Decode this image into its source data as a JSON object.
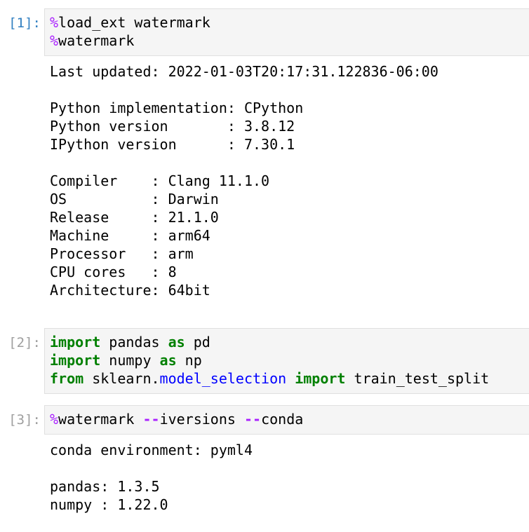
{
  "cells": [
    {
      "prompt": "[1]:",
      "input": {
        "line1": {
          "magic": "%",
          "text": "load_ext watermark"
        },
        "line2": {
          "magic": "%",
          "text": "watermark"
        }
      },
      "output": [
        "Last updated: 2022-01-03T20:17:31.122836-06:00",
        "",
        "Python implementation: CPython",
        "Python version       : 3.8.12",
        "IPython version      : 7.30.1",
        "",
        "Compiler    : Clang 11.1.0",
        "OS          : Darwin",
        "Release     : 21.1.0",
        "Machine     : arm64",
        "Processor   : arm",
        "CPU cores   : 8",
        "Architecture: 64bit"
      ]
    },
    {
      "prompt": "[2]:",
      "input": {
        "line1": {
          "kw1": "import",
          "name": " pandas ",
          "kw2": "as",
          "alias": " pd"
        },
        "line2": {
          "kw1": "import",
          "name": " numpy ",
          "kw2": "as",
          "alias": " np"
        },
        "line3": {
          "kw1": "from",
          "pre": " sklearn.",
          "module": "model_selection",
          "space": " ",
          "kw2": "import",
          "post": " train_test_split"
        }
      }
    },
    {
      "prompt": "[3]:",
      "input": {
        "magic": "%",
        "cmd": "watermark ",
        "op1": "--",
        "arg1": "iversions ",
        "op2": "--",
        "arg2": "conda"
      },
      "output": [
        "conda environment: pyml4",
        "",
        "pandas: 1.3.5",
        "numpy : 1.22.0"
      ]
    }
  ]
}
